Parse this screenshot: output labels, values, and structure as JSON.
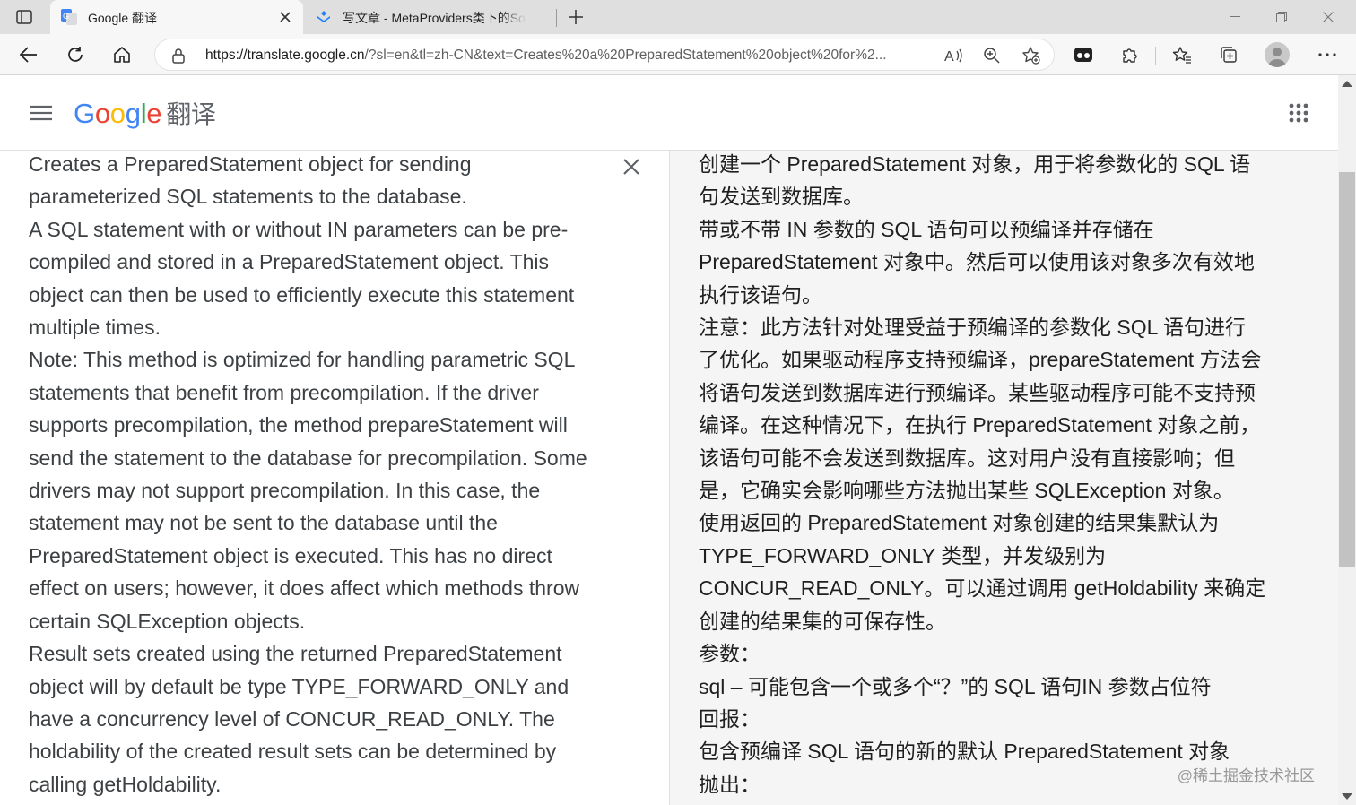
{
  "colors": {
    "tabstrip_bg": "#dfdfdf",
    "toolbar_bg": "#f7f7f7",
    "google_blue": "#4285f4",
    "google_red": "#ea4335",
    "google_yellow": "#fbbc05",
    "google_green": "#34a853",
    "target_panel_bg": "#f5f5f5"
  },
  "browser": {
    "tabs": [
      {
        "title": "Google 翻译",
        "icon": "google-translate-icon",
        "active": true
      },
      {
        "title": "写文章 - MetaProviders类下的So",
        "icon": "juejin-icon",
        "active": false
      }
    ],
    "address_bar": {
      "url_host": "https://translate.google.cn",
      "url_rest": "/?sl=en&tl=zh-CN&text=Creates%20a%20PreparedStatement%20object%20for%2..."
    },
    "toolbar_icons": [
      "back-icon",
      "refresh-icon",
      "home-icon",
      "lock-icon",
      "read-aloud-icon",
      "zoom-icon",
      "add-favorite-icon",
      "extension-icon",
      "puzzle-icon",
      "favorites-icon",
      "collections-icon",
      "profile-icon",
      "more-icon"
    ]
  },
  "header": {
    "logo_letters": [
      "G",
      "o",
      "o",
      "g",
      "l",
      "e"
    ],
    "product_name": "翻译"
  },
  "source": {
    "lines": [
      "Creates a PreparedStatement object for sending",
      "parameterized SQL statements to the database.",
      "A SQL statement with or without IN parameters can be pre-",
      "compiled and stored in a PreparedStatement object. This",
      "object can then be used to efficiently execute this statement",
      "multiple times.",
      "Note: This method is optimized for handling parametric SQL",
      "statements that benefit from precompilation. If the driver",
      "supports precompilation, the method prepareStatement will",
      "send the statement to the database for precompilation. Some",
      "drivers may not support precompilation. In this case, the",
      "statement may not be sent to the database until the",
      "PreparedStatement object is executed. This has no direct",
      "effect on users; however, it does affect which methods throw",
      "certain SQLException objects.",
      "Result sets created using the returned PreparedStatement",
      "object will by default be type TYPE_FORWARD_ONLY and",
      "have a concurrency level of CONCUR_READ_ONLY. The",
      "holdability of the created result sets can be determined by",
      "calling getHoldability."
    ]
  },
  "translation": {
    "lines": [
      "创建一个 PreparedStatement 对象，用于将参数化的 SQL 语",
      "句发送到数据库。",
      "带或不带 IN 参数的 SQL 语句可以预编译并存储在",
      "PreparedStatement 对象中。然后可以使用该对象多次有效地",
      "执行该语句。",
      "注意：此方法针对处理受益于预编译的参数化 SQL 语句进行",
      "了优化。如果驱动程序支持预编译，prepareStatement 方法会",
      "将语句发送到数据库进行预编译。某些驱动程序可能不支持预",
      "编译。在这种情况下，在执行 PreparedStatement 对象之前，",
      "该语句可能不会发送到数据库。这对用户没有直接影响；但",
      "是，它确实会影响哪些方法抛出某些 SQLException 对象。",
      "使用返回的 PreparedStatement 对象创建的结果集默认为",
      "TYPE_FORWARD_ONLY 类型，并发级别为",
      "CONCUR_READ_ONLY。可以通过调用 getHoldability 来确定",
      "创建的结果集的可保存性。",
      "参数：",
      "sql – 可能包含一个或多个“？”的 SQL 语句IN 参数占位符",
      "回报：",
      "包含预编译 SQL 语句的新的默认 PreparedStatement 对象",
      "抛出："
    ]
  },
  "watermark": "@稀土掘金技术社区"
}
